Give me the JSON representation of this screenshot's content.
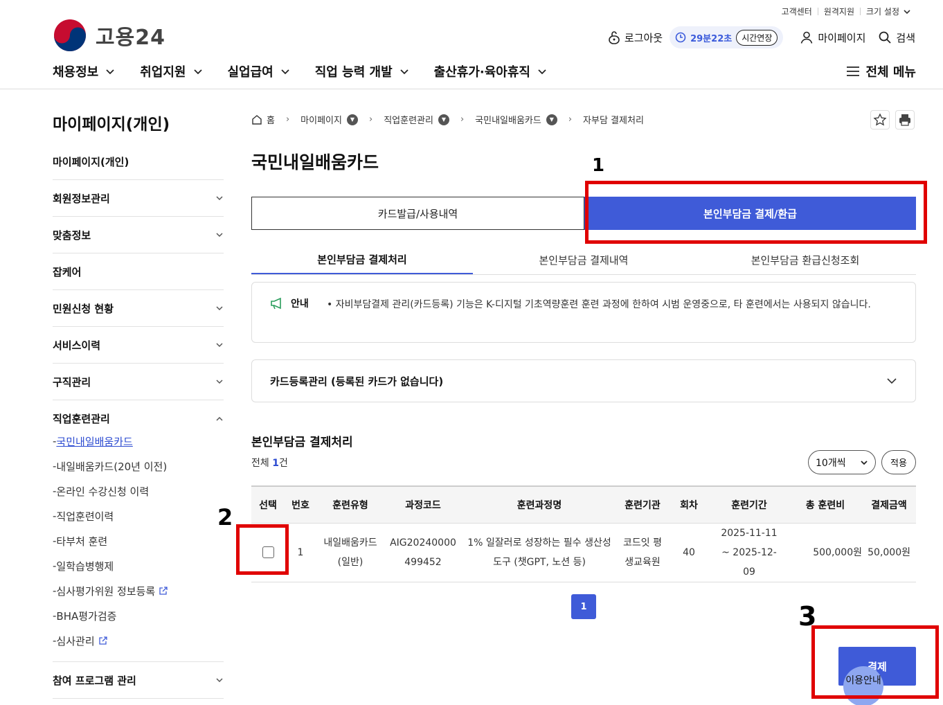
{
  "utility": [
    "고객센터",
    "원격지원",
    "크기 설정"
  ],
  "logo": {
    "text": "고용24"
  },
  "header": {
    "logout": "로그아웃",
    "timer": "29분22초",
    "extend": "시간연장",
    "mypage": "마이페이지",
    "search": "검색"
  },
  "gnb": [
    "채용정보",
    "취업지원",
    "실업급여",
    "직업 능력 개발",
    "출산휴가·육아휴직"
  ],
  "gnb_all": "전체 메뉴",
  "sidebar": {
    "title": "마이페이지(개인)",
    "items": [
      "마이페이지(개인)",
      "회원정보관리",
      "맞춤정보",
      "잡케어",
      "민원신청 현황",
      "서비스이력",
      "구직관리"
    ],
    "group": {
      "label": "직업훈련관리",
      "subs": [
        "국민내일배움카드",
        "내일배움카드(20년 이전)",
        "온라인 수강신청 이력",
        "직업훈련이력",
        "타부처 훈련",
        "일학습병행제",
        "심사평가위원 정보등록",
        "BHA평가검증",
        "심사관리"
      ]
    },
    "last": "참여 프로그램 관리"
  },
  "breadcrumb": [
    "홈",
    "마이페이지",
    "직업훈련관리",
    "국민내일배움카드",
    "자부담 결제처리"
  ],
  "page_title": "국민내일배움카드",
  "tabs": [
    "카드발급/사용내역",
    "본인부담금 결제/환급"
  ],
  "subtabs": [
    "본인부담금 결제처리",
    "본인부담금 결제내역",
    "본인부담금 환급신청조회"
  ],
  "notice": {
    "label": "안내",
    "text": "• 자비부담결제 관리(카드등록) 기능은 K-디지털 기초역량훈련 훈련 과정에 한하여 시범 운영중으로, 타 훈련에서는 사용되지 않습니다."
  },
  "accordion": "카드등록관리 (등록된 카드가 없습니다)",
  "section": {
    "title": "본인부담금 결제처리",
    "total_prefix": "전체 ",
    "total_count": "1",
    "total_suffix": "건"
  },
  "page_size": "10개씩",
  "apply": "적용",
  "table": {
    "headers": [
      "선택",
      "번호",
      "훈련유형",
      "과정코드",
      "훈련과정명",
      "훈련기관",
      "회차",
      "훈련기간",
      "총 훈련비",
      "결제금액"
    ],
    "rows": [
      {
        "no": "1",
        "type": "내일배움카드(일반)",
        "code": "AIG20240000499452",
        "course": "1% 일잘러로 성장하는 필수 생산성 도구 (챗GPT, 노션 등)",
        "org": "코드잇 평생교육원",
        "round": "40",
        "period": "2025-11-11 ~ 2025-12-09",
        "total": "500,000원",
        "pay": "50,000원"
      }
    ]
  },
  "pager": "1",
  "pay_button": "결제",
  "help": "이용안내",
  "annotations": [
    "1",
    "2",
    "3"
  ],
  "colors": {
    "primary": "#3f5bd8",
    "annotation": "#e00000"
  }
}
